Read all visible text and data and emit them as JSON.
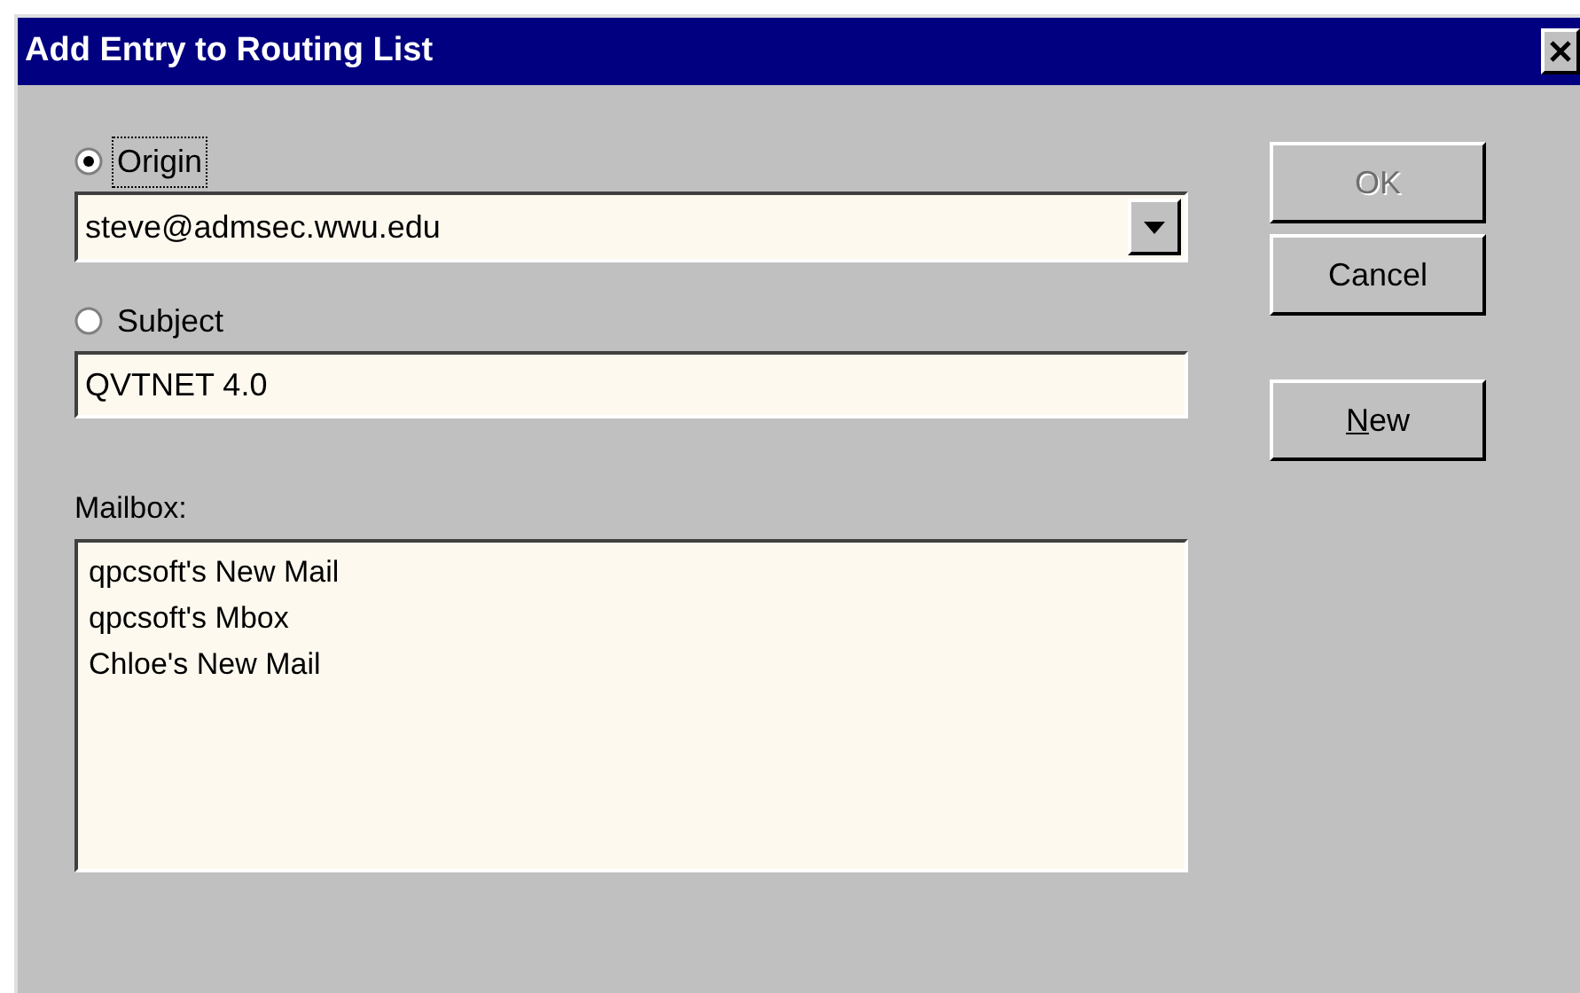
{
  "window": {
    "title": "Add Entry to Routing List"
  },
  "radios": [
    {
      "label": "Origin",
      "selected": true,
      "focused": true,
      "field": {
        "kind": "combo",
        "value": "steve@admsec.wwu.edu"
      }
    },
    {
      "label": "Subject",
      "selected": false,
      "focused": false,
      "field": {
        "kind": "text",
        "value": "QVTNET 4.0"
      }
    }
  ],
  "mailbox": {
    "label": "Mailbox:",
    "items": [
      "qpcsoft's New Mail",
      "qpcsoft's Mbox",
      "Chloe's New Mail"
    ]
  },
  "buttons": [
    {
      "label": "OK",
      "disabled": true,
      "mnemonic": false
    },
    {
      "label": "Cancel",
      "disabled": false,
      "mnemonic": false
    },
    {
      "label": "New",
      "disabled": false,
      "mnemonic": true
    }
  ]
}
